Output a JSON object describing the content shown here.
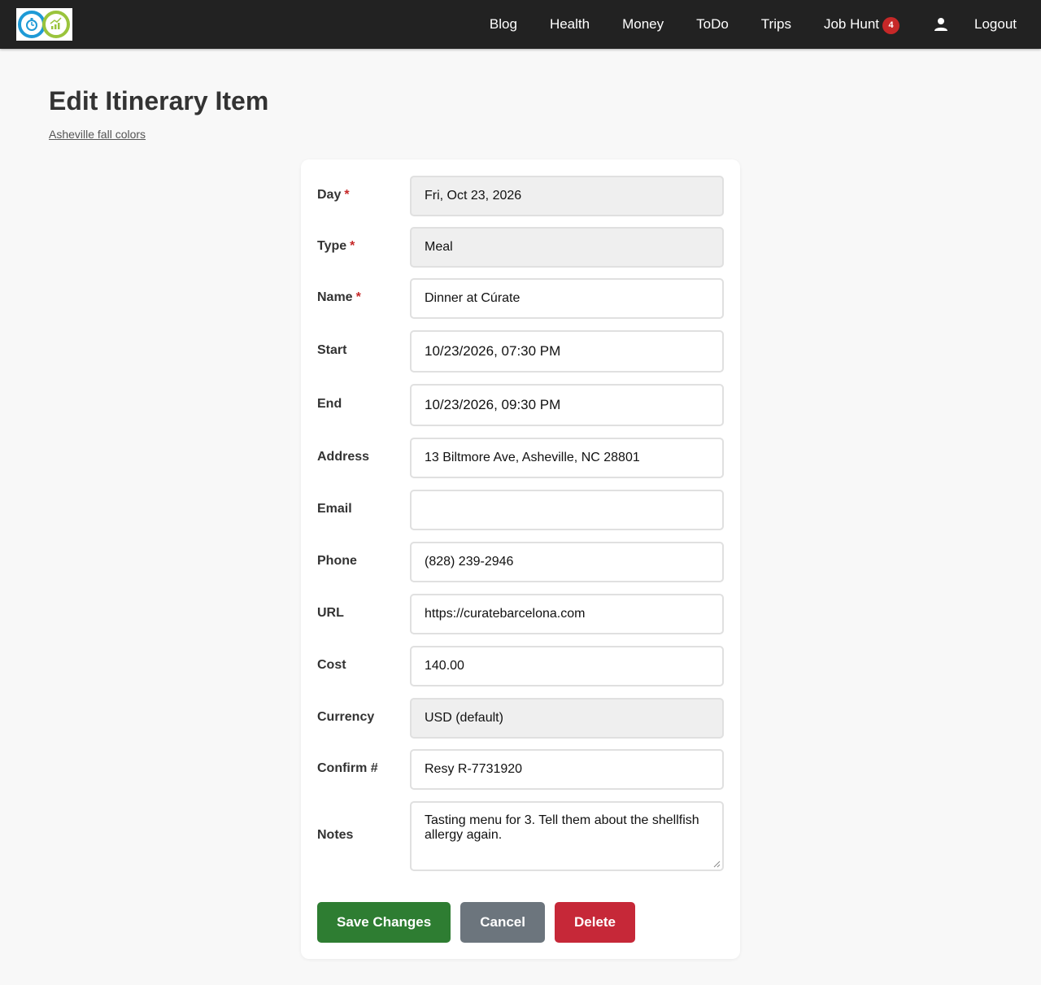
{
  "nav": {
    "items": [
      {
        "label": "Blog"
      },
      {
        "label": "Health"
      },
      {
        "label": "Money"
      },
      {
        "label": "ToDo"
      },
      {
        "label": "Trips"
      },
      {
        "label": "Job Hunt",
        "badge": "4"
      }
    ],
    "logout_label": "Logout",
    "user_icon": "user-icon",
    "logo_icon": "app-logo"
  },
  "page": {
    "title": "Edit Itinerary Item",
    "breadcrumb": "Asheville fall colors"
  },
  "form": {
    "required_marker": "*",
    "day": {
      "label": "Day",
      "value": "Fri, Oct 23, 2026"
    },
    "type": {
      "label": "Type",
      "value": "Meal"
    },
    "name": {
      "label": "Name",
      "value": "Dinner at Cúrate"
    },
    "start": {
      "label": "Start",
      "value": "10/23/2026, 07:30 PM"
    },
    "end": {
      "label": "End",
      "value": "10/23/2026, 09:30 PM"
    },
    "address": {
      "label": "Address",
      "value": "13 Biltmore Ave, Asheville, NC 28801"
    },
    "email": {
      "label": "Email",
      "value": ""
    },
    "phone": {
      "label": "Phone",
      "value": "(828) 239-2946"
    },
    "url": {
      "label": "URL",
      "value": "https://curatebarcelona.com"
    },
    "cost": {
      "label": "Cost",
      "value": "140.00"
    },
    "currency": {
      "label": "Currency",
      "value": "USD (default)"
    },
    "confirm": {
      "label": "Confirm #",
      "value": "Resy R-7731920"
    },
    "notes": {
      "label": "Notes",
      "value": "Tasting menu for 3. Tell them about the shellfish allergy again."
    }
  },
  "actions": {
    "save": "Save Changes",
    "cancel": "Cancel",
    "delete": "Delete"
  },
  "colors": {
    "navbar": "#222222",
    "save": "#2e7d32",
    "cancel": "#6c757d",
    "delete": "#c62838",
    "required": "#c62828",
    "badge": "#c62828"
  }
}
